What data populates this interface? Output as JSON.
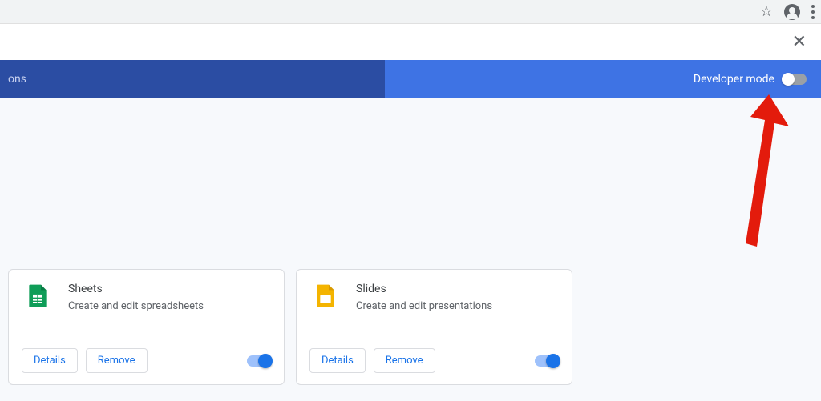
{
  "header": {
    "search_fragment": "ons",
    "developer_mode_label": "Developer mode",
    "developer_mode_on": false
  },
  "cards": [
    {
      "title": "Sheets",
      "desc": "Create and edit spreadsheets",
      "details_label": "Details",
      "remove_label": "Remove",
      "enabled": true
    },
    {
      "title": "Slides",
      "desc": "Create and edit presentations",
      "details_label": "Details",
      "remove_label": "Remove",
      "enabled": true
    }
  ]
}
